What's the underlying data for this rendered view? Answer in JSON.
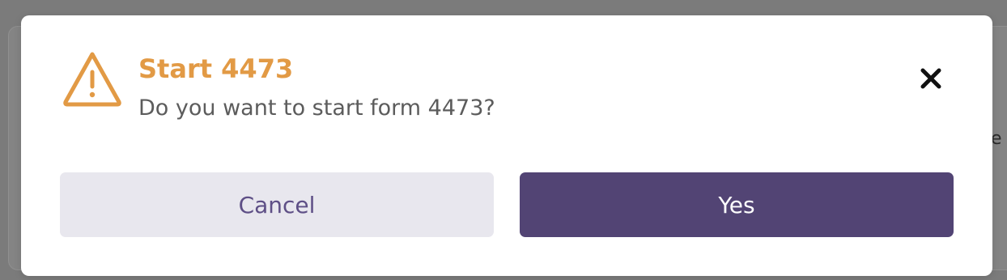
{
  "colors": {
    "warning_accent": "#e29a45",
    "primary": "#524474",
    "secondary_bg": "#e8e7ee",
    "secondary_text": "#5e4f86",
    "primary_text": "#ffffff",
    "close_icon": "#111111"
  },
  "background": {
    "partial_text": "e"
  },
  "dialog": {
    "icon": "warning-triangle-icon",
    "title": "Start 4473",
    "message": "Do you want to start form 4473?",
    "close_icon": "close-icon",
    "buttons": {
      "cancel_label": "Cancel",
      "confirm_label": "Yes"
    }
  }
}
